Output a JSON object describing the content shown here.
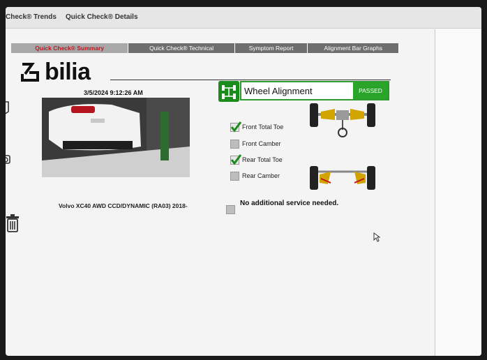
{
  "topnav": {
    "trends": "Check® Trends",
    "details": "Quick Check® Details"
  },
  "tabs": [
    {
      "label": "Quick Check® Summary",
      "active": true
    },
    {
      "label": "Quick Check® Technical",
      "active": false
    },
    {
      "label": "Symptom Report",
      "active": false
    },
    {
      "label": "Alignment Bar Graphs",
      "active": false
    }
  ],
  "logo": {
    "text": "bilia"
  },
  "summary": {
    "datetime": "3/5/2024 9:12:26 AM",
    "vehicle": "Volvo XC40 AWD CCD/DYNAMIC (RA03) 2018-"
  },
  "alignment": {
    "title": "Wheel Alignment",
    "status": "PASSED",
    "checks": [
      {
        "label": "Front Total Toe",
        "checked": true
      },
      {
        "label": "Front Camber",
        "checked": false
      },
      {
        "label": "Rear Total Toe",
        "checked": true
      },
      {
        "label": "Rear Camber",
        "checked": false
      }
    ]
  },
  "service": {
    "text": "No additional service needed.",
    "checked": false
  },
  "colors": {
    "accent_green": "#2aa52a",
    "tab_gray": "#6e6e6e",
    "active_tab_text": "#c0141e"
  }
}
